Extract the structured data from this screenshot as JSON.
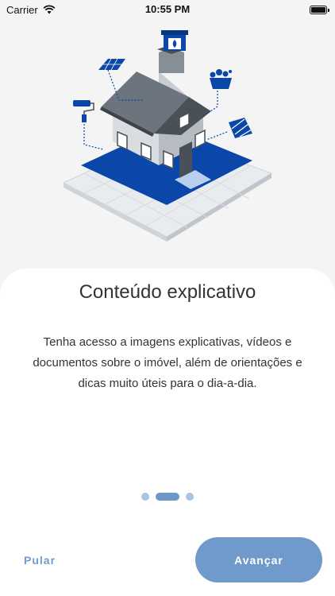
{
  "status_bar": {
    "carrier": "Carrier",
    "time": "10:55 PM",
    "wifi_icon": "wifi-icon",
    "battery_icon": "battery-full-icon"
  },
  "illustration": {
    "subject": "house-illustration-icon",
    "colors": {
      "roof": "#6c757d",
      "walls": "#c9ccd1",
      "blue": "#0a47a8",
      "light_blue": "#b9cfee",
      "floor": "#e6e9ec"
    }
  },
  "onboarding": {
    "title": "Conteúdo explicativo",
    "description": "Tenha acesso a imagens explicativas, vídeos e documentos sobre o imóvel, além de orientações e dicas muito úteis para o dia-a-dia.",
    "pages": 3,
    "current_page": 2,
    "skip_label": "Pular",
    "next_label": "Avançar"
  },
  "colors": {
    "accent": "#6f9acb",
    "dot_inactive": "#a9c4e0",
    "text": "#333333",
    "background": "#f4f4f4",
    "card": "#ffffff"
  }
}
